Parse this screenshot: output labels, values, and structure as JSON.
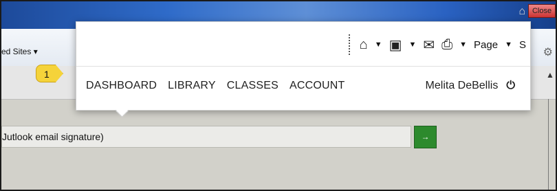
{
  "window": {
    "close_label": "Close"
  },
  "ie_toolbar": {
    "favorites_label": "ed Sites ▾"
  },
  "search_row": {
    "text": "Jutlook email signature)",
    "go_label": "→"
  },
  "popup": {
    "cmdbar": {
      "home_icon": "home-icon",
      "feeds_icon": "rss-icon",
      "mail_icon": "mail-icon",
      "print_icon": "print-icon",
      "page_label": "Page",
      "safety_label": "S"
    },
    "nav": [
      "DASHBOARD",
      "LIBRARY",
      "CLASSES",
      "ACCOUNT"
    ],
    "user_name": "Melita DeBellis"
  },
  "callout": {
    "number": "1",
    "color": "#f5d33a"
  }
}
